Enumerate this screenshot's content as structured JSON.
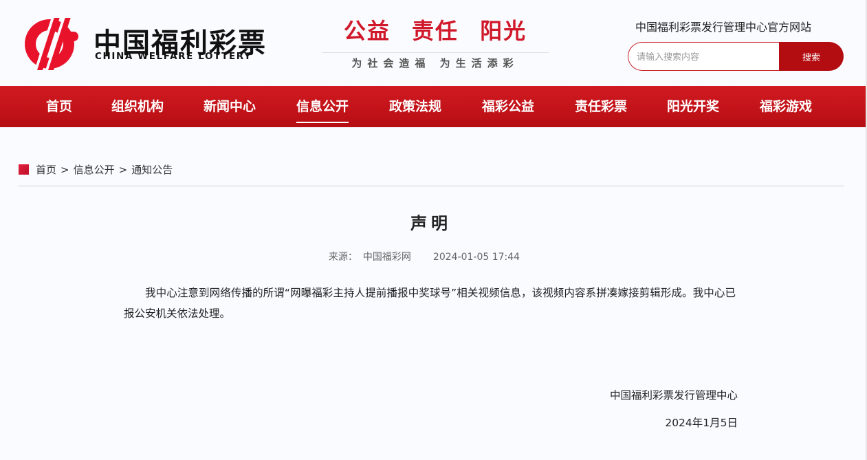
{
  "header": {
    "logo_cn": "中国福利彩票",
    "logo_en": "CHINA WELFARE LOTTERY",
    "slogan_main": "公益  责任  阳光",
    "slogan_sub": "为社会造福 为生活添彩",
    "site_title": "中国福利彩票发行管理中心官方网站",
    "search_placeholder": "请输入搜索内容",
    "search_button": "搜索",
    "brand_color": "#d0182a"
  },
  "nav": {
    "items": [
      {
        "label": "首页"
      },
      {
        "label": "组织机构"
      },
      {
        "label": "新闻中心"
      },
      {
        "label": "信息公开",
        "active": true
      },
      {
        "label": "政策法规"
      },
      {
        "label": "福彩公益"
      },
      {
        "label": "责任彩票"
      },
      {
        "label": "阳光开奖"
      },
      {
        "label": "福彩游戏"
      }
    ]
  },
  "breadcrumb": {
    "items": [
      "首页",
      "信息公开",
      "通知公告"
    ],
    "separator": ">"
  },
  "article": {
    "title": "声明",
    "source_label": "来源：",
    "source": "中国福彩网",
    "datetime": "2024-01-05 17:44",
    "body": "我中心注意到网络传播的所谓“网曝福彩主持人提前播报中奖球号”相关视频信息，该视频内容系拼凑嫁接剪辑形成。我中心已报公安机关依法处理。",
    "sign_org": "中国福利彩票发行管理中心",
    "sign_date": "2024年1月5日"
  }
}
